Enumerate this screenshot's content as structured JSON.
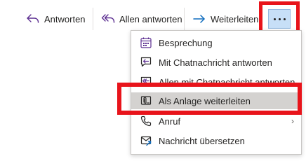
{
  "toolbar": {
    "reply_label": "Antworten",
    "reply_all_label": "Allen antworten",
    "forward_label": "Weiterleiten",
    "reply_icon": "reply-icon",
    "reply_all_icon": "reply-all-icon",
    "forward_icon": "forward-arrow-icon",
    "more_icon": "more-options-icon"
  },
  "menu": {
    "items": [
      {
        "label": "Besprechung",
        "icon": "calendar-icon"
      },
      {
        "label": "Mit Chatnachricht antworten",
        "icon": "chat-reply-icon"
      },
      {
        "label": "Allen mit Chatnachricht antworten",
        "icon": "chat-reply-all-icon"
      },
      {
        "label": "Als Anlage weiterleiten",
        "icon": "attachment-icon",
        "selected": true
      },
      {
        "label": "Anruf",
        "icon": "phone-icon",
        "submenu": true
      },
      {
        "label": "Nachricht übersetzen",
        "icon": "translate-icon"
      }
    ]
  },
  "colors": {
    "accent": "#5c2e91",
    "highlight_red": "#e8141b",
    "more_button_bg": "#c7dff7",
    "forward_arrow": "#0f6cbd",
    "selected_row": "#d4d2d0"
  }
}
